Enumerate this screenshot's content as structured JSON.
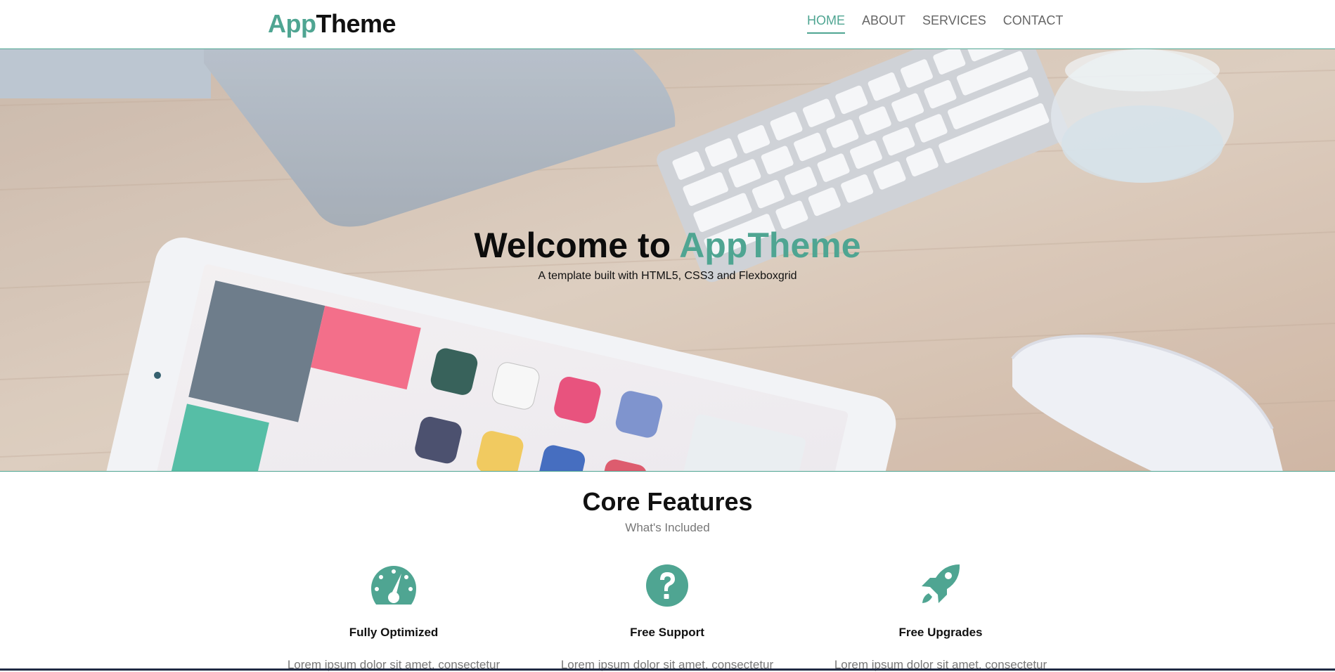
{
  "brand": {
    "part1": "App",
    "part2": "Theme",
    "accent_color": "#4fa592"
  },
  "nav": {
    "items": [
      {
        "label": "HOME",
        "active": true
      },
      {
        "label": "ABOUT",
        "active": false
      },
      {
        "label": "SERVICES",
        "active": false
      },
      {
        "label": "CONTACT",
        "active": false
      }
    ]
  },
  "hero": {
    "title_prefix": "Welcome to ",
    "title_accent": "AppTheme",
    "subtitle": "A template built with HTML5, CSS3 and Flexboxgrid"
  },
  "features": {
    "title": "Core Features",
    "subtitle": "What's Included",
    "items": [
      {
        "icon": "dashboard-icon",
        "title": "Fully Optimized",
        "text": "Lorem ipsum dolor sit amet, consectetur"
      },
      {
        "icon": "question-circle-icon",
        "title": "Free Support",
        "text": "Lorem ipsum dolor sit amet, consectetur"
      },
      {
        "icon": "rocket-icon",
        "title": "Free Upgrades",
        "text": "Lorem ipsum dolor sit amet, consectetur"
      }
    ]
  }
}
